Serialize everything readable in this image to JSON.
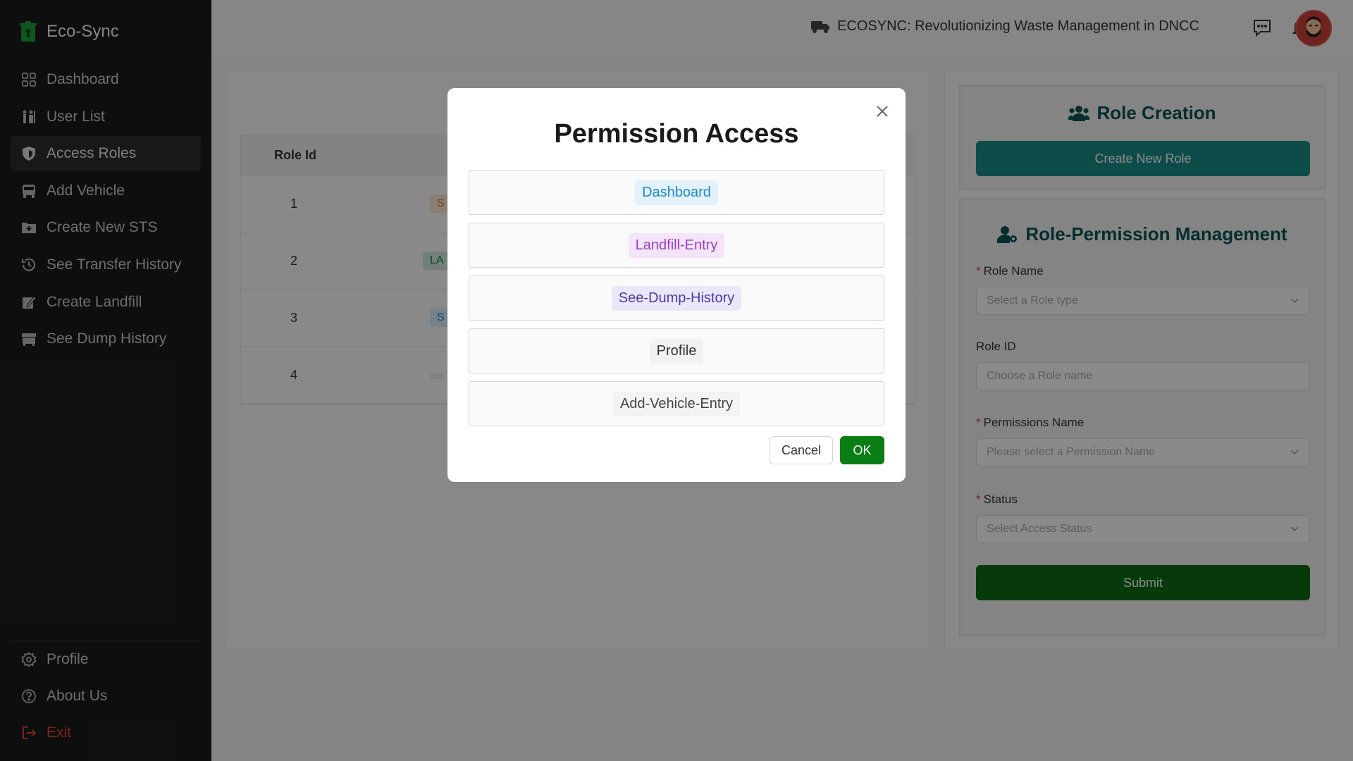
{
  "brand": {
    "name": "Eco-Sync"
  },
  "sidebar": {
    "items": [
      {
        "label": "Dashboard"
      },
      {
        "label": "User List"
      },
      {
        "label": "Access Roles"
      },
      {
        "label": "Add Vehicle"
      },
      {
        "label": "Create New STS"
      },
      {
        "label": "See Transfer History"
      },
      {
        "label": "Create Landfill"
      },
      {
        "label": "See Dump History"
      }
    ],
    "bottom": [
      {
        "label": "Profile"
      },
      {
        "label": "About Us"
      },
      {
        "label": "Exit"
      }
    ],
    "active": "Access Roles"
  },
  "header": {
    "title": "ECOSYNC: Revolutionizing Waste Management in DNCC"
  },
  "table": {
    "header": "Role Id",
    "rows": [
      {
        "id": "1",
        "tag": "S"
      },
      {
        "id": "2",
        "tag": "LA"
      },
      {
        "id": "3",
        "tag": "S"
      },
      {
        "id": "4",
        "tag": ""
      }
    ]
  },
  "role_creation": {
    "title": "Role Creation",
    "button": "Create New Role"
  },
  "role_permission": {
    "title": "Role-Permission Management",
    "role_name_label": "Role Name",
    "role_name_placeholder": "Select a Role type",
    "role_id_label": "Role ID",
    "role_id_placeholder": "Choose a Role name",
    "permissions_label": "Permissions Name",
    "permissions_placeholder": "Please select a Permission Name",
    "status_label": "Status",
    "status_placeholder": "Select Access Status",
    "submit": "Submit"
  },
  "modal": {
    "title": "Permission Access",
    "permissions": [
      {
        "label": "Dashboard",
        "color": "#1d87c7",
        "bg": "#e2f1fb"
      },
      {
        "label": "Landfill-Entry",
        "color": "#9a3ec9",
        "bg": "#f4e4fb"
      },
      {
        "label": "See-Dump-History",
        "color": "#4b3aa6",
        "bg": "#ebe7fb"
      },
      {
        "label": "Profile",
        "color": "#333333",
        "bg": "#f2f2f2"
      },
      {
        "label": "Add-Vehicle-Entry",
        "color": "#444444",
        "bg": "#f3f3f3"
      }
    ],
    "cancel": "Cancel",
    "ok": "OK"
  },
  "colors": {
    "accent_teal": "#1a8b86",
    "accent_green": "#0d6b14",
    "ok_green": "#0a7d15",
    "sidebar_bg": "#1b1b1b"
  }
}
